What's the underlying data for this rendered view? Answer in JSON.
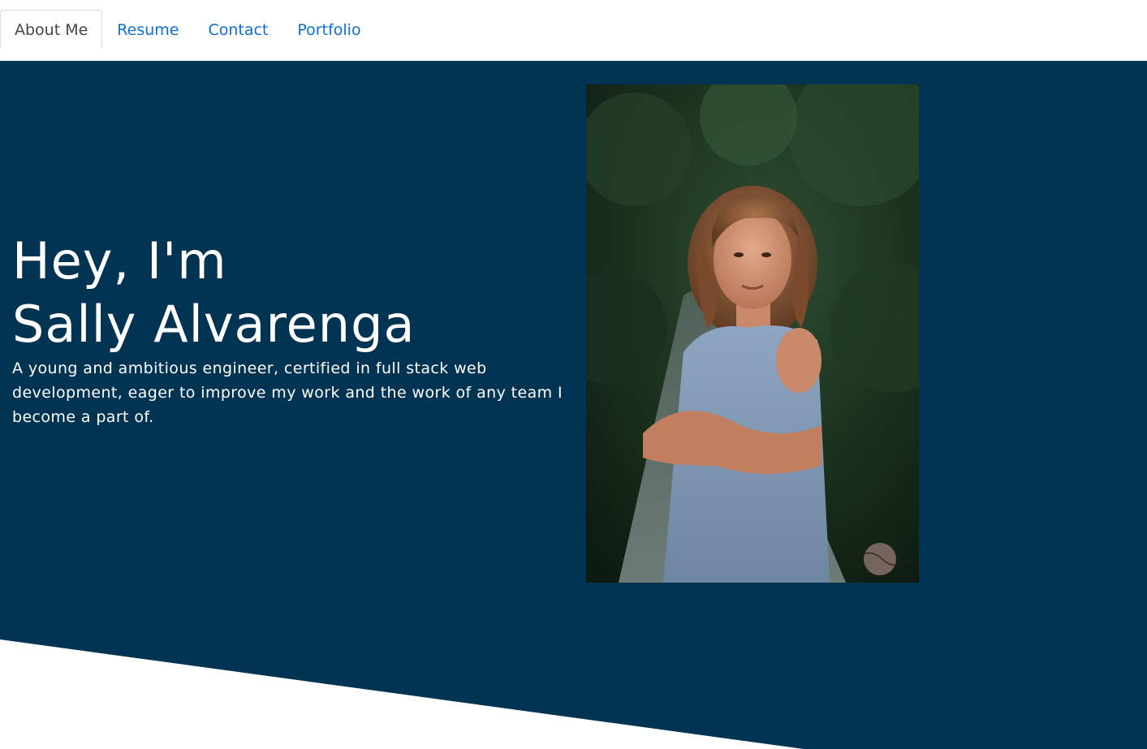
{
  "nav": {
    "tabs": [
      {
        "label": "About Me",
        "active": true
      },
      {
        "label": "Resume",
        "active": false
      },
      {
        "label": "Contact",
        "active": false
      },
      {
        "label": "Portfolio",
        "active": false
      }
    ]
  },
  "hero": {
    "greeting": "Hey, I'm",
    "name": "Sally Alvarenga",
    "bio": "A young and ambitious engineer, certified in full stack web development, eager to improve my work and the work of any team I become a part of.",
    "background_color": "#003452"
  },
  "colors": {
    "link": "#0a6fd6",
    "active_tab_text": "#454545"
  }
}
